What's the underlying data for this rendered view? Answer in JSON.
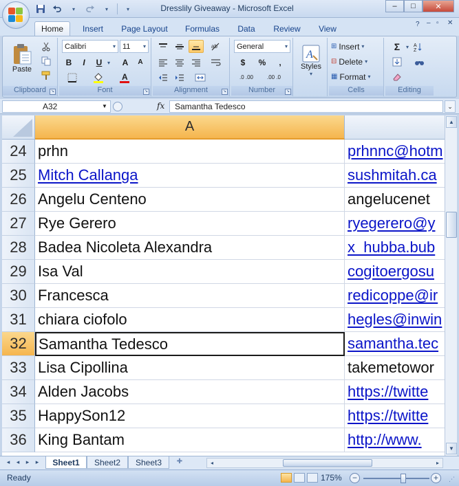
{
  "window": {
    "title": "Dresslily Giveaway - Microsoft Excel",
    "controls": {
      "minimize": "–",
      "maximize": "□",
      "close": "✕"
    }
  },
  "quick_access": {
    "save_icon": "save-icon",
    "undo_icon": "undo-icon",
    "redo_icon": "redo-icon",
    "customize_icon": "customize-icon"
  },
  "ribbon_tabs": [
    {
      "label": "Home",
      "active": true
    },
    {
      "label": "Insert",
      "active": false
    },
    {
      "label": "Page Layout",
      "active": false
    },
    {
      "label": "Formulas",
      "active": false
    },
    {
      "label": "Data",
      "active": false
    },
    {
      "label": "Review",
      "active": false
    },
    {
      "label": "View",
      "active": false
    }
  ],
  "ribbon": {
    "clipboard": {
      "label": "Clipboard",
      "paste_label": "Paste"
    },
    "font": {
      "label": "Font",
      "font_name": "Calibri",
      "font_size": "11",
      "bold": "B",
      "italic": "I",
      "underline": "U",
      "grow": "A",
      "shrink": "A"
    },
    "alignment": {
      "label": "Alignment"
    },
    "number": {
      "label": "Number",
      "format": "General",
      "currency": "$",
      "percent": "%",
      "comma": ",",
      "inc_dec": ".0 .00",
      "dec_dec": ".00 .0"
    },
    "styles": {
      "label": "Styles"
    },
    "cells": {
      "label": "Cells",
      "insert": "Insert",
      "delete": "Delete",
      "format": "Format"
    },
    "editing": {
      "label": "Editing",
      "sum": "Σ"
    }
  },
  "formula_bar": {
    "name_box": "A32",
    "fx_label": "fx",
    "formula": "Samantha Tedesco"
  },
  "grid": {
    "column_a_header": "A",
    "selected_row": "32",
    "rows": [
      {
        "row": "24",
        "name": "prhn",
        "name_link": false,
        "email": "prhnnc@hotm",
        "email_link": true
      },
      {
        "row": "25",
        "name": "Mitch Callanga",
        "name_link": true,
        "email": "sushmitah.ca",
        "email_link": true
      },
      {
        "row": "26",
        "name": "Angelu Centeno",
        "name_link": false,
        "email": "angelucenet",
        "email_link": false
      },
      {
        "row": "27",
        "name": "Rye Gerero",
        "name_link": false,
        "email": "ryegerero@y",
        "email_link": true
      },
      {
        "row": "28",
        "name": "Badea Nicoleta Alexandra",
        "name_link": false,
        "email": "x_hubba.bub",
        "email_link": true
      },
      {
        "row": "29",
        "name": "Isa Val",
        "name_link": false,
        "email": "cogitoergosu",
        "email_link": true
      },
      {
        "row": "30",
        "name": "Francesca",
        "name_link": false,
        "email": "redicoppe@ir",
        "email_link": true
      },
      {
        "row": "31",
        "name": "chiara ciofolo",
        "name_link": false,
        "email": "hegles@inwin",
        "email_link": true
      },
      {
        "row": "32",
        "name": "Samantha Tedesco",
        "name_link": false,
        "email": "samantha.tec",
        "email_link": true
      },
      {
        "row": "33",
        "name": "Lisa Cipollina",
        "name_link": false,
        "email": "takemetowor",
        "email_link": false
      },
      {
        "row": "34",
        "name": "Alden Jacobs",
        "name_link": false,
        "email": "https://twitte",
        "email_link": true
      },
      {
        "row": "35",
        "name": "HappySon12",
        "name_link": false,
        "email": "https://twitte",
        "email_link": true
      },
      {
        "row": "36",
        "name": "King Bantam",
        "name_link": false,
        "email": "http://www.",
        "email_link": true
      }
    ]
  },
  "sheet_tabs": [
    {
      "label": "Sheet1",
      "active": true
    },
    {
      "label": "Sheet2",
      "active": false
    },
    {
      "label": "Sheet3",
      "active": false
    }
  ],
  "status": {
    "text": "Ready",
    "zoom": "175%",
    "zoom_out": "−",
    "zoom_in": "+",
    "zoom_fraction": 0.6
  },
  "colors": {
    "accent": "#f5b54e",
    "link": "#0a14c8",
    "ribbon": "#c7d9ef"
  }
}
